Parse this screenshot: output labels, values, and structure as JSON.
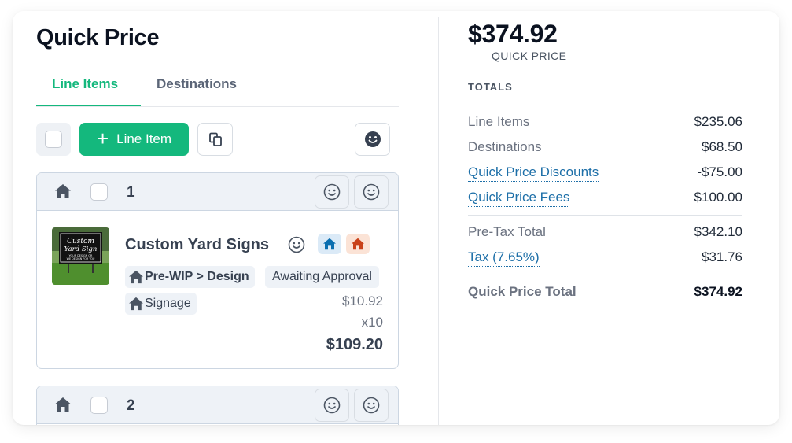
{
  "header": {
    "title": "Quick Price"
  },
  "tabs": [
    {
      "label": "Line Items",
      "active": true
    },
    {
      "label": "Destinations",
      "active": false
    }
  ],
  "toolbar": {
    "add_label": "Line Item"
  },
  "line_items": [
    {
      "number": "1",
      "product": {
        "name": "Custom Yard Signs",
        "thumb_text": [
          "Custom",
          "Yard Sign",
          "YOUR DESIGN OR",
          "WE DESIGN FOR YOU"
        ],
        "tags": [
          "Pre-WIP > Design",
          "Awaiting Approval",
          "Signage"
        ],
        "unit_price": "$10.92",
        "quantity": "x10",
        "total": "$109.20"
      }
    },
    {
      "number": "2"
    }
  ],
  "summary": {
    "total": "$374.92",
    "total_caption": "QUICK PRICE",
    "section_title": "TOTALS",
    "rows": [
      {
        "label": "Line Items",
        "value": "$235.06"
      },
      {
        "label": "Destinations",
        "value": "$68.50"
      },
      {
        "label": "Quick Price Discounts",
        "value": "-$75.00"
      },
      {
        "label": "Quick Price Fees",
        "value": "$100.00"
      },
      {
        "label": "Pre-Tax Total",
        "value": "$342.10"
      },
      {
        "label": "Tax (7.65%)",
        "value": "$31.76"
      },
      {
        "label": "Quick Price Total",
        "value": "$374.92"
      }
    ]
  },
  "icons": [
    "home-icon",
    "smiley-icon",
    "copy-icon",
    "plus-icon"
  ],
  "colors": {
    "accent": "#14b87d",
    "link": "#1d6fa8",
    "home_blue": "#0b6fb0",
    "home_orange": "#c9421a"
  }
}
